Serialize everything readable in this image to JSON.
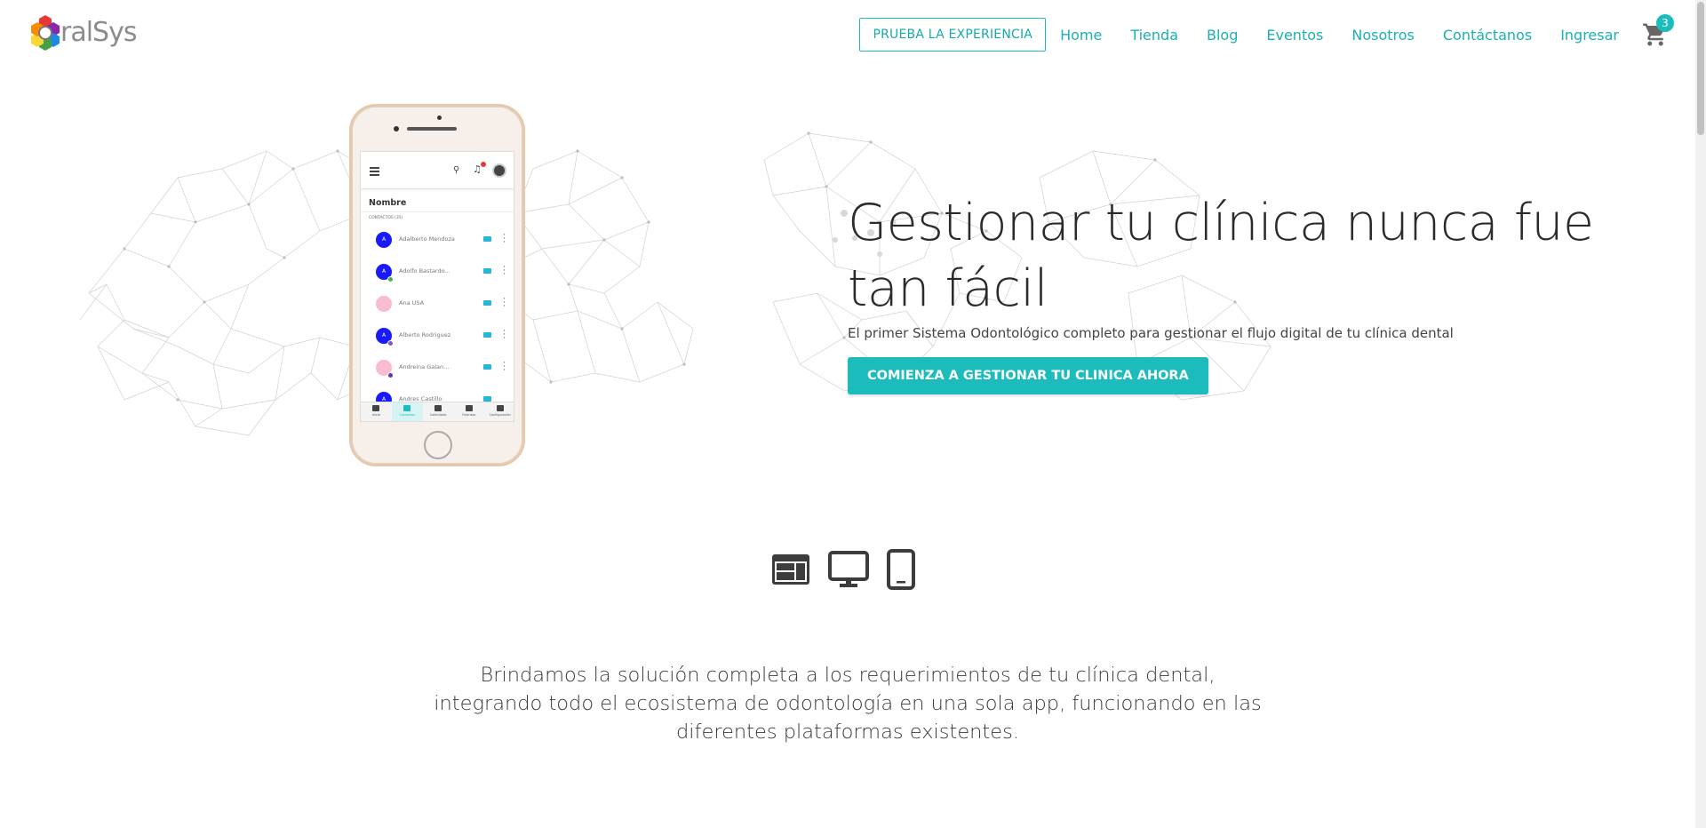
{
  "header": {
    "logo_text": "ralSys",
    "cta_label": "PRUEBA LA EXPERIENCIA",
    "nav": [
      "Home",
      "Tienda",
      "Blog",
      "Eventos",
      "Nosotros",
      "Contáctanos",
      "Ingresar"
    ],
    "cart_count": "3",
    "accent_color": "#1dbcbc"
  },
  "hero": {
    "title": "Gestionar tu clínica nunca fue tan fácil",
    "subtitle": "El primer Sistema Odontológico completo para gestionar el flujo digital de tu clínica dental",
    "cta_label": "COMIENZA A GESTIONAR TU CLINICA AHORA"
  },
  "phone_app": {
    "section_title": "Nombre",
    "group_label": "CONTACTOS (35)",
    "contacts": [
      {
        "name": "Adalberto Mendoza",
        "initial": "A"
      },
      {
        "name": "Adolfo Bastardo...",
        "initial": "A"
      },
      {
        "name": "Ana USA",
        "initial": ""
      },
      {
        "name": "Alberto Rodriguez",
        "initial": "A"
      },
      {
        "name": "Andreina Galan...",
        "initial": ""
      },
      {
        "name": "Andres Castillo",
        "initial": "A"
      }
    ],
    "tabs": [
      "Inicio",
      "Contactos",
      "Calendario",
      "Finanzas",
      "Configuración"
    ],
    "notification_count": "5",
    "fab_label": "+"
  },
  "platform_icons": [
    "web-app-icon",
    "desktop-icon",
    "smartphone-icon"
  ],
  "description": {
    "line1": "Brindamos la solución completa a los requerimientos de tu clínica dental,",
    "line2": "integrando todo el ecosistema de odontología en una sola app, funcionando en las",
    "line3": "diferentes plataformas existentes."
  }
}
